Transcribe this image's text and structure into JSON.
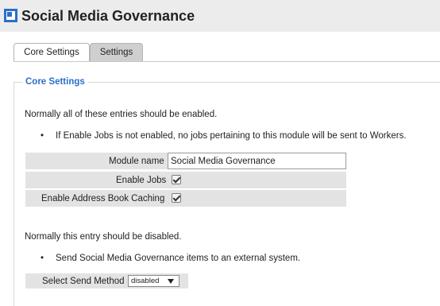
{
  "app": {
    "title": "Social Media Governance",
    "icon": "module-icon"
  },
  "tabs": [
    {
      "label": "Core Settings",
      "active": true
    },
    {
      "label": "Settings",
      "active": false
    }
  ],
  "section": {
    "legend": "Core Settings",
    "intro": "Normally all of these entries should be enabled.",
    "bullet": "If Enable Jobs is not enabled, no jobs pertaining to this module will be sent to Workers.",
    "fields": {
      "module_name_label": "Module name",
      "module_name_value": "Social Media Governance",
      "enable_jobs_label": "Enable Jobs",
      "enable_jobs_checked": true,
      "address_book_label": "Enable Address Book Caching",
      "address_book_checked": true
    },
    "intro2": "Normally this entry should be disabled.",
    "bullet2": "Send Social Media Governance items to an external system.",
    "send_method": {
      "label": "Select Send Method",
      "value": "disabled"
    }
  },
  "colors": {
    "accent": "#2a6fc9",
    "row_bg": "#e3e3e3",
    "header_bg": "#ececec"
  }
}
